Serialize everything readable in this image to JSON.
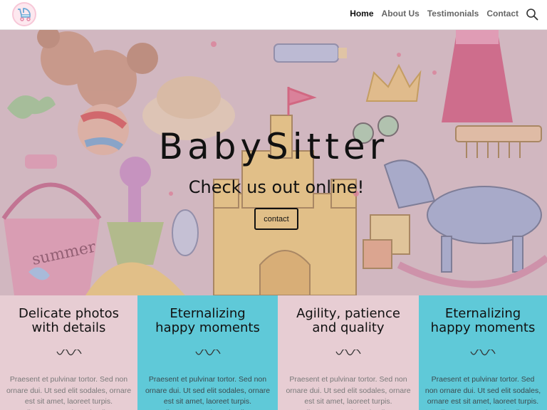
{
  "header": {
    "logo_icon": "baby-stroller-icon",
    "nav": [
      {
        "label": "Home",
        "active": true
      },
      {
        "label": "About Us",
        "active": false
      },
      {
        "label": "Testimonials",
        "active": false
      },
      {
        "label": "Contact",
        "active": false
      }
    ],
    "search_icon": "search-icon"
  },
  "hero": {
    "title": "BabySitter",
    "subtitle": "Check us out online!",
    "button_label": "contact"
  },
  "features": [
    {
      "title_line1": "Delicate photos",
      "title_line2": "with details",
      "text": "Praesent et pulvinar tortor. Sed non ornare dui. Ut sed elit sodales, ornare est sit amet, laoreet turpis. Pellentesque euismod nulla ac",
      "color": "#e7cdd3"
    },
    {
      "title_line1": "Eternalizing",
      "title_line2": "happy moments",
      "text": "Praesent et pulvinar tortor. Sed non ornare dui. Ut sed elit sodales, ornare est sit amet, laoreet turpis. Pellentesque euismod nulla ac",
      "color": "#5fc9d8"
    },
    {
      "title_line1": "Agility, patience",
      "title_line2": "and quality",
      "text": "Praesent et pulvinar tortor. Sed non ornare dui. Ut sed elit sodales, ornare est sit amet, laoreet turpis. Pellentesque euismod nulla ac",
      "color": "#e7cdd3"
    },
    {
      "title_line1": "Eternalizing",
      "title_line2": "happy moments",
      "text": "Praesent et pulvinar tortor. Sed non ornare dui. Ut sed elit sodales, ornare est sit amet, laoreet turpis. Pellentesque euismod nulla ac",
      "color": "#5fc9d8"
    }
  ],
  "colors": {
    "pink": "#e7cdd3",
    "teal": "#5fc9d8",
    "nav_active": "#111111",
    "nav_inactive": "#666666"
  }
}
